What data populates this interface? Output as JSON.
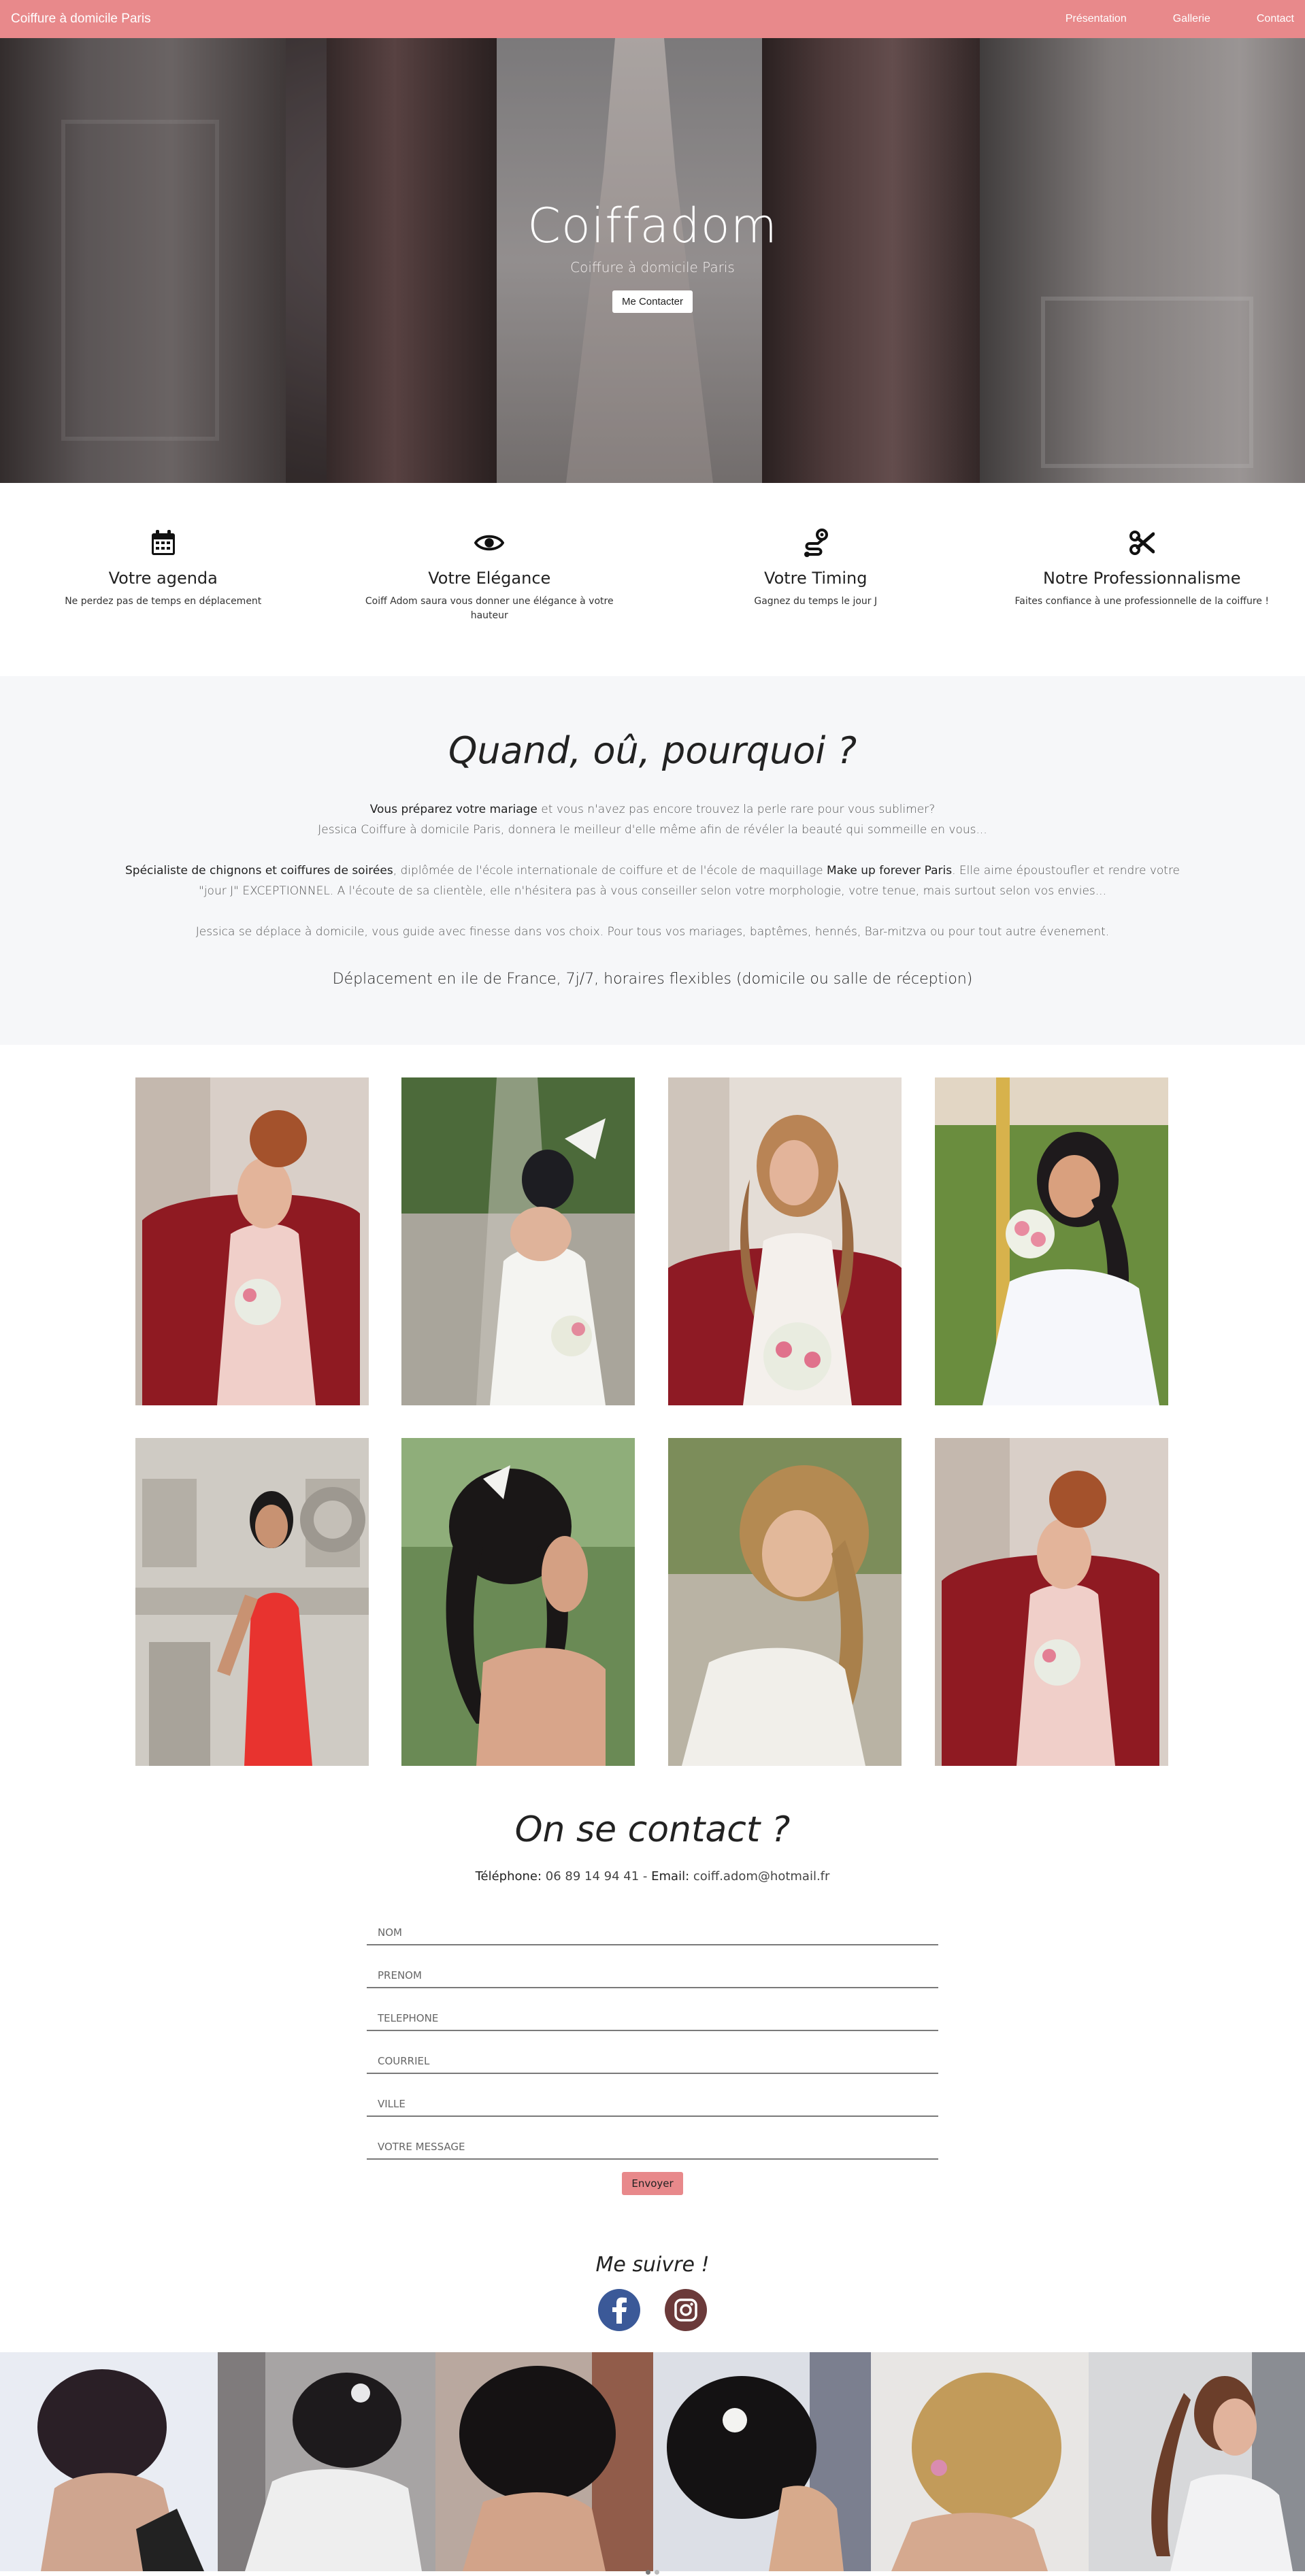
{
  "navbar": {
    "brand": "Coiffure à domicile Paris",
    "links": [
      "Présentation",
      "Gallerie",
      "Contact"
    ]
  },
  "hero": {
    "title": "Coiffadom",
    "subtitle": "Coiffure à domicile Paris",
    "button": "Me Contacter"
  },
  "features": [
    {
      "icon": "calendar-icon",
      "title": "Votre agenda",
      "text": "Ne perdez pas de temps en déplacement"
    },
    {
      "icon": "eye-icon",
      "title": "Votre Elégance",
      "text": "Coiff Adom saura vous donner une élégance à votre hauteur"
    },
    {
      "icon": "route-icon",
      "title": "Votre Timing",
      "text": "Gagnez du temps le jour J"
    },
    {
      "icon": "scissors-icon",
      "title": "Notre Professionnalisme",
      "text": "Faites confiance à une professionnelle de la coiffure !"
    }
  ],
  "about": {
    "title": "Quand, oû, pourquoi ?",
    "p1_bold": "Vous préparez votre mariage",
    "p1_rest": " et vous n'avez pas encore trouvez la perle rare pour vous sublimer?",
    "p1_line2": "Jessica Coiffure à domicile Paris, donnera le meilleur d'elle même afin de révéler la beauté qui sommeille en vous...",
    "p2_bold1": "Spécialiste de chignons et coiffures de soirées",
    "p2_mid": ", diplômée de l'école internationale de coiffure et de l'école de maquillage ",
    "p2_bold2": "Make up forever Paris",
    "p2_rest": ". Elle aime époustoufler et rendre votre \"jour J\" EXCEPTIONNEL. A l'écoute de sa clientèle, elle n'hésitera pas à vous conseiller selon votre morphologie, votre tenue, mais surtout selon vos envies...",
    "p3": "Jessica se déplace à domicile, vous guide avec finesse dans vos choix. Pour tous vos mariages, baptêmes, hennés, Bar-mitzva ou pour tout autre évenement.",
    "move": "Déplacement en ile de France, 7j/7, horaires flexibles (domicile ou salle de réception)"
  },
  "contact": {
    "title": "On se contact ?",
    "phone_label": "Téléphone:",
    "phone": " 06 89 14 94 41 - ",
    "email_label": "Email:",
    "email": " coiff.adom@hotmail.fr",
    "fields": [
      "NOM",
      "PRENOM",
      "TELEPHONE",
      "COURRIEL",
      "VILLE",
      "VOTRE MESSAGE"
    ],
    "send": "Envoyer"
  },
  "follow": {
    "title": "Me suivre !",
    "icons": [
      "facebook-icon",
      "instagram-icon"
    ],
    "facebook_color": "#3b5998",
    "instagram_color": "#6b3a3a"
  },
  "colors": {
    "accent": "#e8898b"
  }
}
